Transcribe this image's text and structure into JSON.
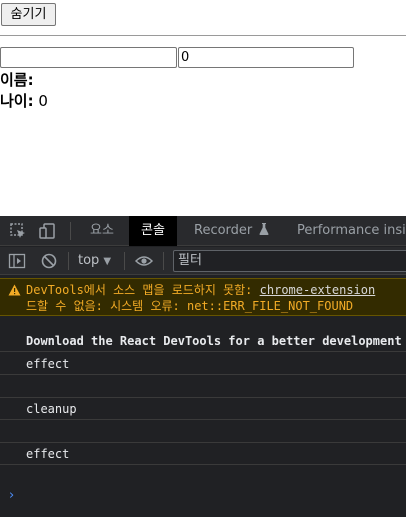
{
  "page": {
    "hide_button_label": "숨기기",
    "name_input_value": "",
    "age_input_value": "0",
    "name_label": "이름:",
    "name_value": "",
    "age_label": "나이:",
    "age_value": "0"
  },
  "devtools": {
    "tabs": {
      "elements": "요소",
      "console": "콘솔",
      "recorder": "Recorder",
      "performance": "Performance insigh"
    },
    "toolbar": {
      "context": "top",
      "filter_placeholder": "필터"
    },
    "console": {
      "warning_line1_prefix": "DevTools에서 소스 맵을 로드하지 못함: ",
      "warning_link": "chrome-extension",
      "warning_line2": "드할 수 없음: 시스템 오류: net::ERR_FILE_NOT_FOUND",
      "messages": [
        "Download the React DevTools for a better development",
        "effect",
        "",
        "cleanup",
        "",
        "effect"
      ]
    },
    "colors": {
      "active_tab_bg": "#000000",
      "warning_text": "#f2ab26",
      "warning_bg": "#332b00",
      "prompt": "#4d90fe"
    },
    "icons": [
      "inspect-element-icon",
      "device-toolbar-icon",
      "sidebar-toggle-icon",
      "clear-console-icon",
      "eye-icon",
      "warning-icon",
      "flask-icon",
      "prompt-chevron-icon"
    ]
  }
}
